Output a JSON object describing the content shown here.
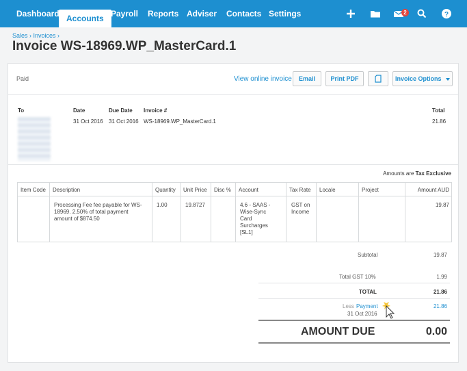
{
  "nav": {
    "items": [
      {
        "label": "Dashboard"
      },
      {
        "label": "Accounts"
      },
      {
        "label": "Payroll"
      },
      {
        "label": "Reports"
      },
      {
        "label": "Adviser"
      },
      {
        "label": "Contacts"
      },
      {
        "label": "Settings"
      }
    ],
    "mail_badge": "2"
  },
  "breadcrumb": "Sales › Invoices ›",
  "title": "Invoice WS-18969.WP_MasterCard.1",
  "status": "Paid",
  "actions": {
    "view_online": "View online invoice",
    "email": "Email",
    "print_pdf": "Print PDF",
    "invoice_options": "Invoice Options"
  },
  "header": {
    "to_label": "To",
    "date_label": "Date",
    "date": "31 Oct 2016",
    "due_date_label": "Due Date",
    "due_date": "31 Oct 2016",
    "invoice_no_label": "Invoice #",
    "invoice_no": "WS-18969.WP_MasterCard.1",
    "total_label": "Total",
    "total": "21.86"
  },
  "amounts_are": {
    "label": "Amounts are",
    "value": "Tax Exclusive"
  },
  "table": {
    "columns": [
      "Item Code",
      "Description",
      "Quantity",
      "Unit Price",
      "Disc %",
      "Account",
      "Tax Rate",
      "Locale",
      "Project",
      "Amount AUD"
    ],
    "row": {
      "item_code": "",
      "description": [
        "Processing Fee fee payable for WS-",
        "18969. 2.50% of total payment",
        "amount of $874.50"
      ],
      "quantity": "1.00",
      "unit_price": "19.8727",
      "disc": "",
      "account": [
        "4.6 - SAAS -",
        "Wise-Sync",
        "Card",
        "Surcharges",
        "[SL1]"
      ],
      "tax_rate": [
        "GST on",
        "Income"
      ],
      "locale": "",
      "project": "",
      "amount": "19.87"
    }
  },
  "totals": {
    "subtotal_label": "Subtotal",
    "subtotal": "19.87",
    "gst_label": "Total GST  10%",
    "gst": "1.99",
    "total_label": "TOTAL",
    "total": "21.86",
    "less_label": "Less",
    "payment_link": "Payment",
    "payment_date": "31 Oct 2016",
    "payment_amount": "21.86",
    "amount_due_label": "AMOUNT DUE",
    "amount_due": "0.00"
  },
  "colors": {
    "nav_bg": "#1d8fd0",
    "link": "#1d8fd0",
    "badge": "#e2463d"
  }
}
